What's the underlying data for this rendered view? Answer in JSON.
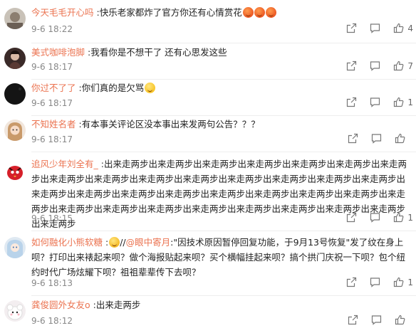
{
  "comments": [
    {
      "user": "今天毛毛开心吗",
      "sep": " :",
      "text": "快乐老家都炸了官方你还有心情赏花",
      "emojis": [
        "angry",
        "angry",
        "angry"
      ],
      "time": "9-6 18:22",
      "likes": "4"
    },
    {
      "user": "美式咖啡泡脚",
      "sep": " :",
      "text": "我看你是不想干了 还有心思发这些",
      "time": "9-6 18:17",
      "likes": "7"
    },
    {
      "user": "你过不了了",
      "sep": " :",
      "text": "你们真的是欠骂",
      "emojis": [
        "smile"
      ],
      "time": "9-6 18:17",
      "likes": "1"
    },
    {
      "user": "不知姓名者",
      "sep": " :",
      "text": "有本事关评论区没本事出来发两句公告？？？",
      "time": "9-6 18:17",
      "likes": ""
    },
    {
      "user": "追风少年刘全有_",
      "sep": " :",
      "text": "出来走两步出来走两步出来走两步出来走两步出来走两步出来走两步出来走两步出来走两步出来走两步出来走两步出来走两步出来走两步出来走两步出来走两步出来走两步出来走两步出来走两步出来走两步出来走两步出来走两步出来走两步出来走两步出来走两步出来走两步出来走两步出来走两步出来走两步出来走两步出来走两步出来走两步出来走两步出来走两步出来走两步",
      "time": "9-6 18:15",
      "likes": "1"
    },
    {
      "user": "如何融化小熊软糖",
      "sep": " :",
      "mention_prefix": "//",
      "mention": "@眼中寄月",
      "text2": ":\"因技术原因暂停回复功能，于9月13号恢复\"发了纹在身上呗？打印出来裱起来呗？做个海报贴起来呗？买个横幅挂起来呗？搞个拱门庆祝一下呗？包个纽约时代广场炫耀下呗？祖祖辈辈传下去呗？",
      "emojis": [
        "grin"
      ],
      "time": "9-6 18:13",
      "likes": "1"
    },
    {
      "user": "龚俊圆外女友o",
      "sep": " :",
      "text": "出来走两步",
      "time": "9-6 18:12",
      "likes": ""
    }
  ],
  "colors": {
    "username": "#eb7350",
    "text": "#222222",
    "meta": "#888888",
    "divider": "#eeeeee"
  },
  "icons": {
    "share": "share-icon",
    "comment": "comment-icon",
    "like": "thumbs-up-icon"
  }
}
